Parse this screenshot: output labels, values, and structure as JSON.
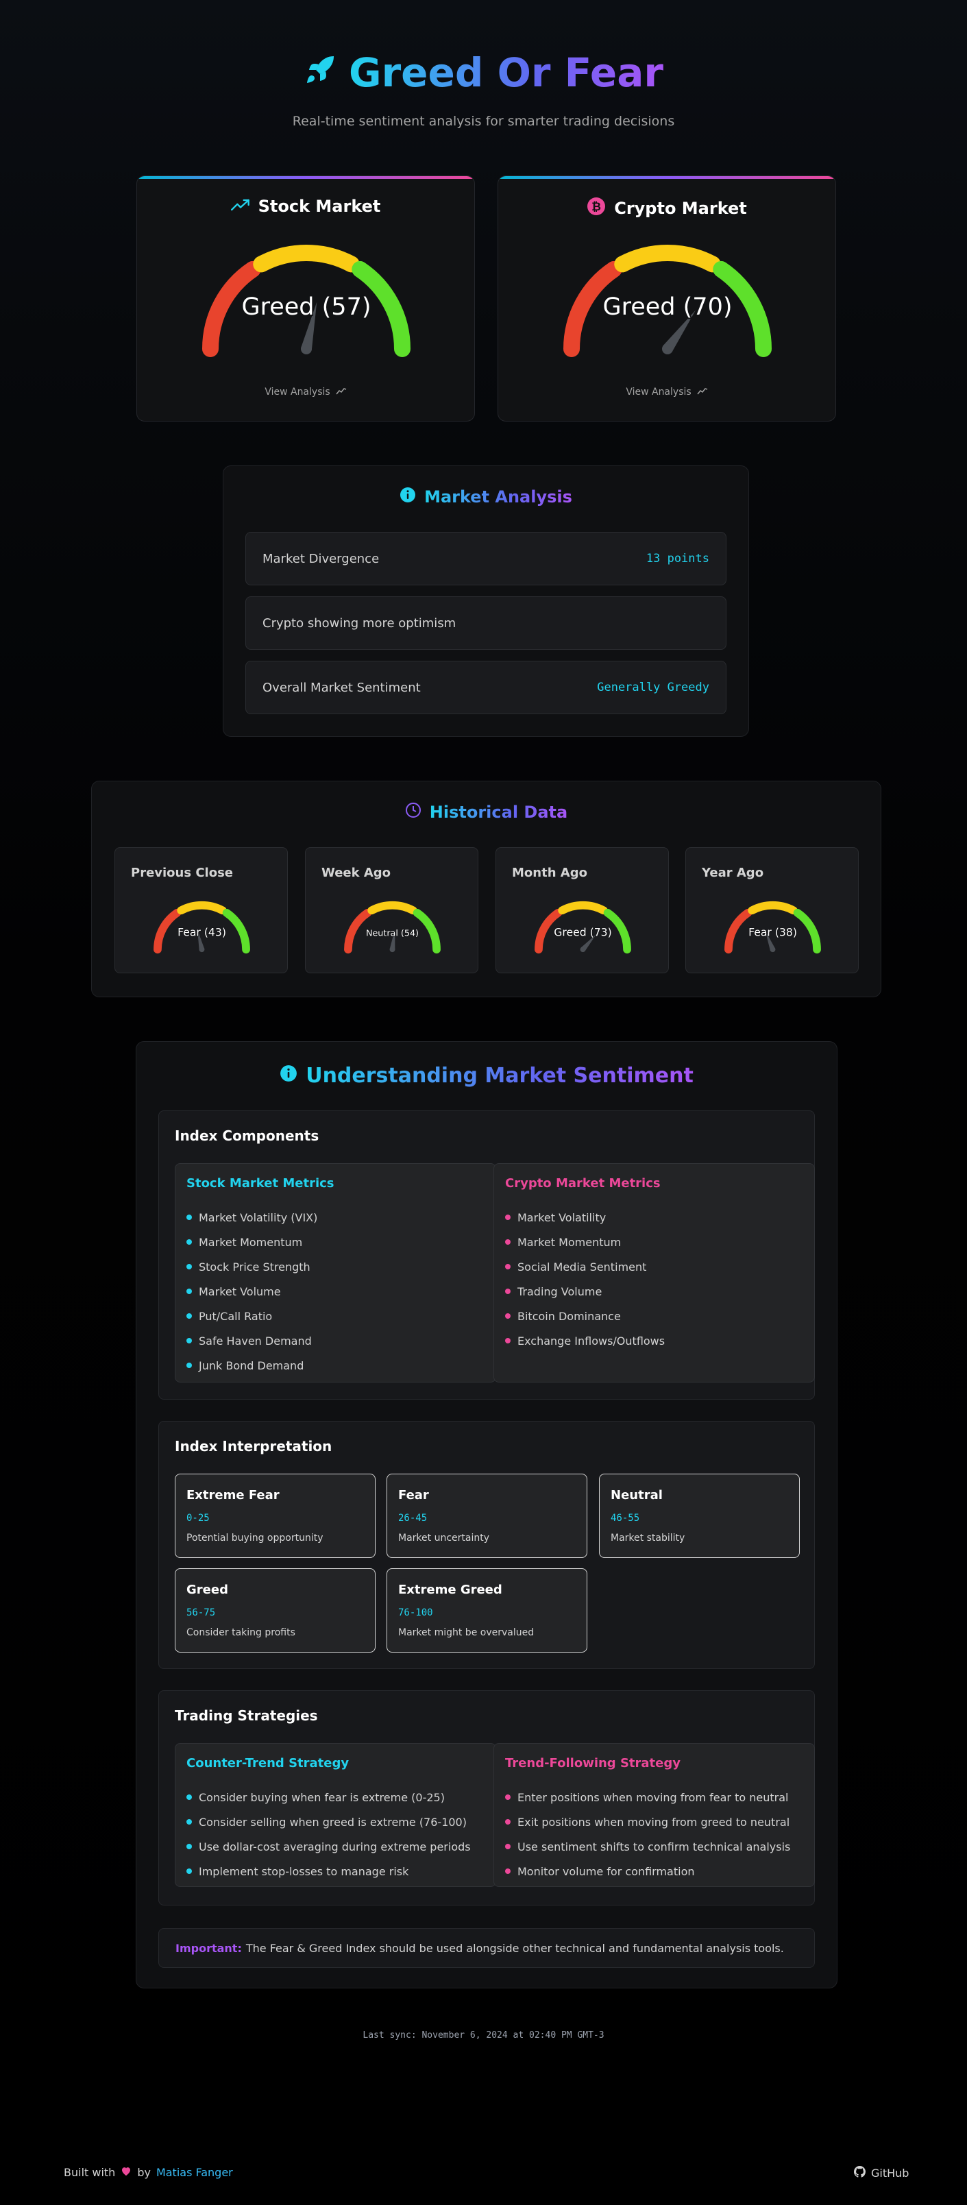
{
  "header": {
    "title": "Greed Or Fear",
    "subtitle": "Real-time sentiment analysis for smarter trading decisions"
  },
  "markets": [
    {
      "title": "Stock Market",
      "label": "Greed (57)",
      "value": 57,
      "link": "View Analysis",
      "icon": "trending-up-icon"
    },
    {
      "title": "Crypto Market",
      "label": "Greed (70)",
      "value": 70,
      "link": "View Analysis",
      "icon": "bitcoin-icon"
    }
  ],
  "analysis": {
    "title": "Market Analysis",
    "rows": [
      {
        "label": "Market Divergence",
        "value": "13 points"
      },
      {
        "label": "Crypto showing more optimism",
        "value": ""
      },
      {
        "label": "Overall Market Sentiment",
        "value": "Generally Greedy"
      }
    ]
  },
  "historical": {
    "title": "Historical Data",
    "items": [
      {
        "title": "Previous Close",
        "label": "Fear (43)",
        "value": 43
      },
      {
        "title": "Week Ago",
        "label": "Neutral (54)",
        "value": 54
      },
      {
        "title": "Month Ago",
        "label": "Greed (73)",
        "value": 73
      },
      {
        "title": "Year Ago",
        "label": "Fear (38)",
        "value": 38
      }
    ]
  },
  "understanding": {
    "title": "Understanding Market Sentiment",
    "components": {
      "title": "Index Components",
      "stock": {
        "title": "Stock Market Metrics",
        "items": [
          "Market Volatility (VIX)",
          "Market Momentum",
          "Stock Price Strength",
          "Market Volume",
          "Put/Call Ratio",
          "Safe Haven Demand",
          "Junk Bond Demand"
        ]
      },
      "crypto": {
        "title": "Crypto Market Metrics",
        "items": [
          "Market Volatility",
          "Market Momentum",
          "Social Media Sentiment",
          "Trading Volume",
          "Bitcoin Dominance",
          "Exchange Inflows/Outflows"
        ]
      }
    },
    "interpretation": {
      "title": "Index Interpretation",
      "items": [
        {
          "name": "Extreme Fear",
          "range": "0-25",
          "desc": "Potential buying opportunity"
        },
        {
          "name": "Fear",
          "range": "26-45",
          "desc": "Market uncertainty"
        },
        {
          "name": "Neutral",
          "range": "46-55",
          "desc": "Market stability"
        },
        {
          "name": "Greed",
          "range": "56-75",
          "desc": "Consider taking profits"
        },
        {
          "name": "Extreme Greed",
          "range": "76-100",
          "desc": "Market might be overvalued"
        }
      ]
    },
    "strategies": {
      "title": "Trading Strategies",
      "counter": {
        "title": "Counter-Trend Strategy",
        "items": [
          "Consider buying when fear is extreme (0-25)",
          "Consider selling when greed is extreme (76-100)",
          "Use dollar-cost averaging during extreme periods",
          "Implement stop-losses to manage risk"
        ]
      },
      "trend": {
        "title": "Trend-Following Strategy",
        "items": [
          "Enter positions when moving from fear to neutral",
          "Exit positions when moving from greed to neutral",
          "Use sentiment shifts to confirm technical analysis",
          "Monitor volume for confirmation"
        ]
      }
    },
    "note": {
      "label": "Important:",
      "text": "The Fear & Greed Index should be used alongside other technical and fundamental analysis tools."
    }
  },
  "footer": {
    "sync": "Last sync: November 6, 2024 at 02:40 PM GMT-3",
    "built_with": "Built with",
    "by": "by",
    "author": "Matias Fanger",
    "github": "GitHub"
  },
  "colors": {
    "red": "#e8442d",
    "yellow": "#facc15",
    "green": "#5ee02b",
    "cyan": "#22d3ee",
    "pink": "#ec4899",
    "purple": "#a855f7"
  }
}
